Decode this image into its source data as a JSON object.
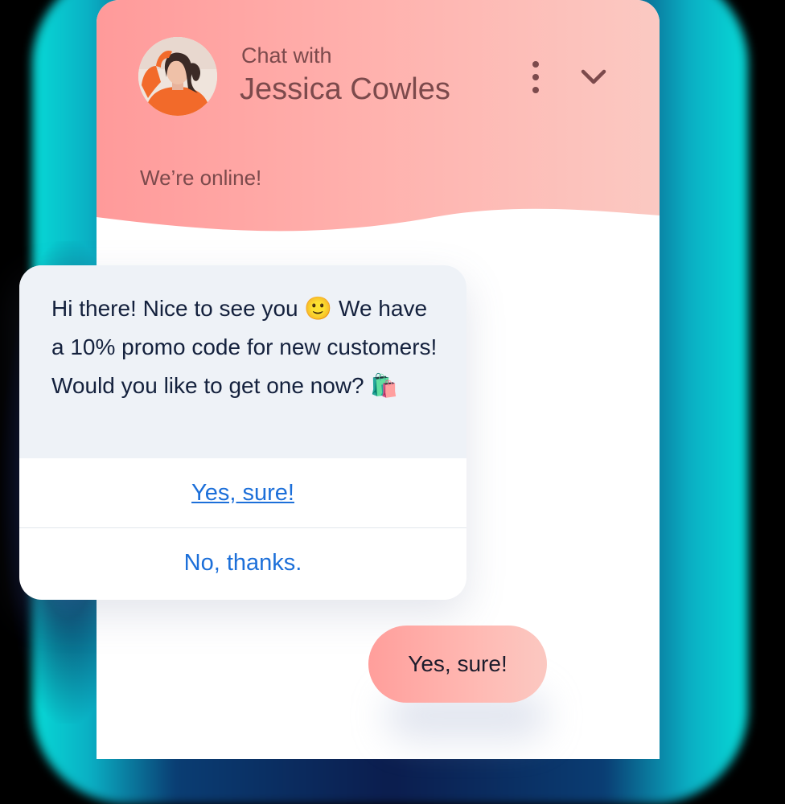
{
  "header": {
    "caption": "Chat with",
    "agent_name": "Jessica Cowles",
    "status": "We’re online!"
  },
  "message": {
    "text": "Hi there! Nice to see you",
    "emoji_smile": "🙂",
    "text_rest": "We have a 10% promo code for new customers! Would you like to get one now?",
    "emoji_bag": "🛍️"
  },
  "options": {
    "yes": "Yes, sure!",
    "no": "No, thanks."
  },
  "reply": {
    "text": "Yes, sure!"
  },
  "colors": {
    "header_gradient_start": "#ff9a9a",
    "header_gradient_end": "#fbc9c2",
    "link": "#1c6fd9",
    "header_text": "#7c4a4c",
    "bubble_bg": "#eef2f7"
  },
  "icons": {
    "menu": "more-vertical-icon",
    "collapse": "chevron-down-icon"
  }
}
